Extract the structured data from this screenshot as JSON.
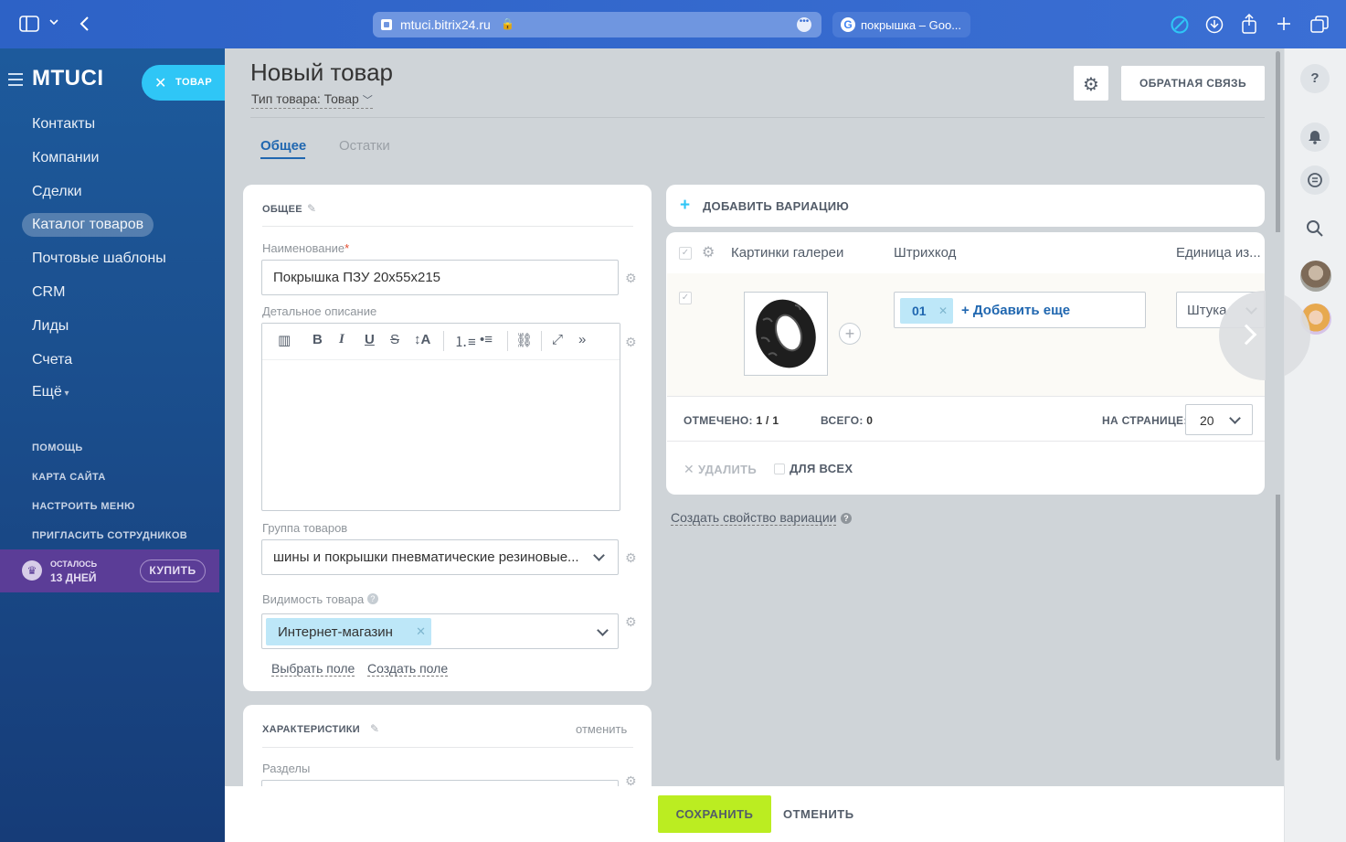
{
  "browser": {
    "url": "mtuci.bitrix24.ru",
    "second_tab": "покрышка – Goo..."
  },
  "sidebar": {
    "logo": "MTUCI",
    "close_button_label": "ТОВАР",
    "items": [
      {
        "label": "Контакты"
      },
      {
        "label": "Компании"
      },
      {
        "label": "Сделки"
      },
      {
        "label": "Каталог товаров",
        "active": true
      },
      {
        "label": "Почтовые шаблоны"
      },
      {
        "label": "CRM"
      },
      {
        "label": "Лиды"
      },
      {
        "label": "Счета"
      },
      {
        "label": "Ещё"
      }
    ],
    "secondary": [
      "ПОМОЩЬ",
      "КАРТА САЙТА",
      "НАСТРОИТЬ МЕНЮ",
      "ПРИГЛАСИТЬ СОТРУДНИКОВ"
    ],
    "trial": {
      "line1": "ОСТАЛОСЬ",
      "line2": "13 ДНЕЙ",
      "buy": "КУПИТЬ"
    }
  },
  "header": {
    "title": "Новый товар",
    "type": "Тип товара: Товар",
    "feedback": "ОБРАТНАЯ СВЯЗЬ",
    "tabs": [
      "Общее",
      "Остатки"
    ]
  },
  "general": {
    "section_title": "ОБЩЕЕ",
    "name_label": "Наименование",
    "name_value": "Покрышка ПЗУ 20х55х215",
    "desc_label": "Детальное описание",
    "group_label": "Группа товаров",
    "group_value": "шины и покрышки пневматические резиновые...",
    "visibility_label": "Видимость товара",
    "visibility_tag": "Интернет-магазин",
    "select_field": "Выбрать поле",
    "create_field": "Создать поле"
  },
  "characteristics": {
    "section_title": "ХАРАКТЕРИСТИКИ",
    "cancel": "отменить",
    "sections_label": "Разделы"
  },
  "variations": {
    "add_variation": "ДОБАВИТЬ ВАРИАЦИЮ",
    "columns": [
      "Картинки галереи",
      "Штрихкод",
      "Единица из..."
    ],
    "barcode_chip": "01",
    "barcode_add": "+ Добавить еще",
    "unit": "Штука",
    "selected_label": "ОТМЕЧЕНО:",
    "selected_value": "1 / 1",
    "total_label": "ВСЕГО:",
    "total_value": "0",
    "per_page_label": "НА СТРАНИЦЕ:",
    "per_page_value": "20",
    "delete": "УДАЛИТЬ",
    "for_all": "ДЛЯ ВСЕХ",
    "create_property": "Создать свойство вариации"
  },
  "footer": {
    "save": "СОХРАНИТЬ",
    "cancel": "ОТМЕНИТЬ"
  }
}
